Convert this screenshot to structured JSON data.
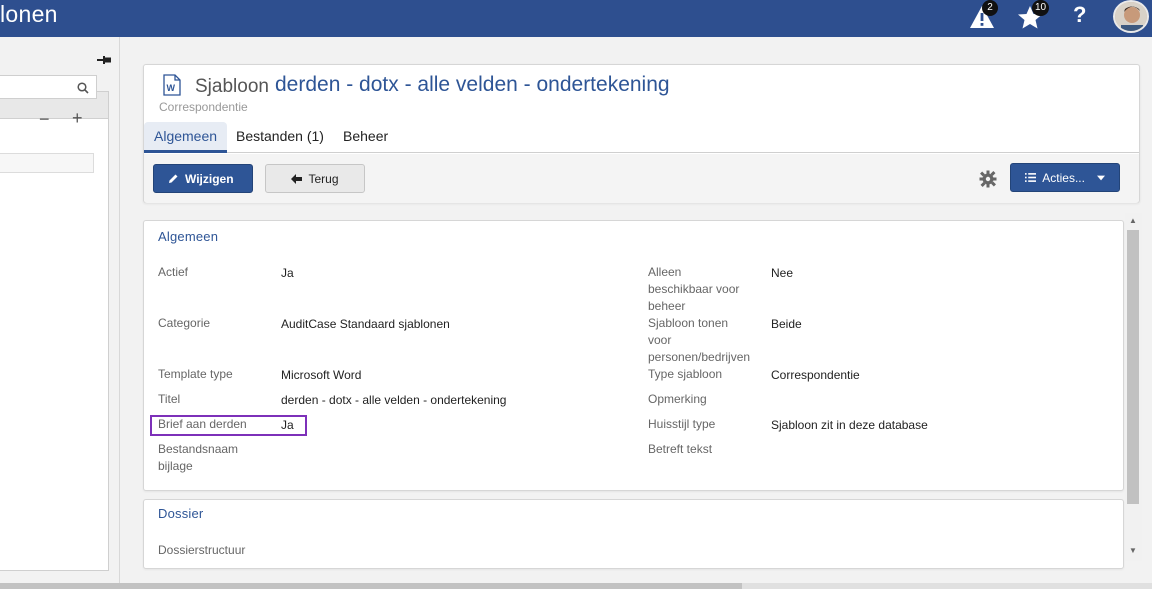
{
  "app": {
    "title": "lonen"
  },
  "topbar": {
    "alerts_count": "2",
    "favorites_count": "10",
    "help_label": "?"
  },
  "header": {
    "type_label": "Sjabloon",
    "title": "derden - dotx - alle velden - ondertekening",
    "subtitle": "Correspondentie",
    "tabs": [
      {
        "label": "Algemeen"
      },
      {
        "label": "Bestanden (1)"
      },
      {
        "label": "Beheer"
      }
    ]
  },
  "toolbar": {
    "edit_label": "Wijzigen",
    "back_label": "Terug",
    "actions_label": "Acties..."
  },
  "general": {
    "title": "Algemeen",
    "left_fields": [
      {
        "label": "Actief",
        "value": "Ja"
      },
      {
        "label": "Categorie",
        "value": "AuditCase Standaard sjablonen"
      },
      {
        "label": "Template type",
        "value": "Microsoft Word"
      },
      {
        "label": "Titel",
        "value": "derden - dotx - alle velden - ondertekening"
      },
      {
        "label": "Brief aan derden",
        "value": "Ja"
      },
      {
        "label": "Bestandsnaam\nbijlage",
        "value": ""
      }
    ],
    "right_fields": [
      {
        "label": "Alleen\nbeschikbaar voor\nbeheer",
        "value": "Nee"
      },
      {
        "label": "Sjabloon tonen\nvoor\npersonen/bedrijven",
        "value": "Beide"
      },
      {
        "label": "Type sjabloon",
        "value": "Correspondentie"
      },
      {
        "label": "Opmerking",
        "value": ""
      },
      {
        "label": "Huisstijl type",
        "value": "Sjabloon zit in deze database"
      },
      {
        "label": "Betreft tekst",
        "value": ""
      }
    ]
  },
  "dossier": {
    "title": "Dossier",
    "fields": [
      {
        "label": "Dossierstructuur",
        "value": ""
      }
    ]
  },
  "colors": {
    "brand": "#2e4f8f",
    "accent": "#2e5596",
    "highlight": "#7d30b9"
  }
}
